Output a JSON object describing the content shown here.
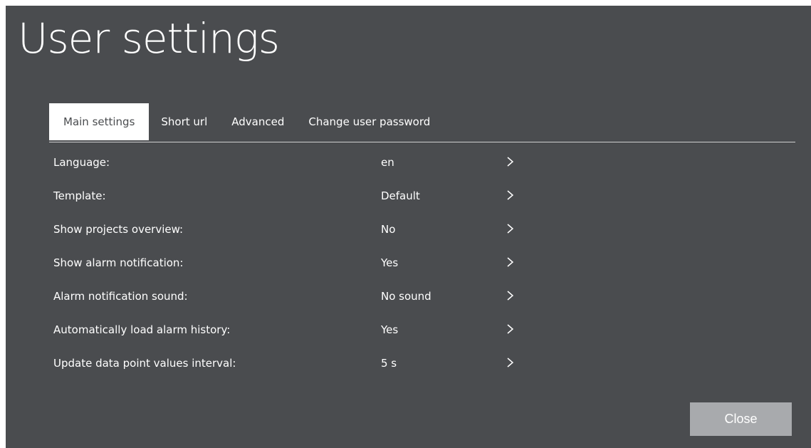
{
  "dialog": {
    "title": "User settings"
  },
  "tabs": [
    {
      "label": "Main settings",
      "active": true
    },
    {
      "label": "Short url",
      "active": false
    },
    {
      "label": "Advanced",
      "active": false
    },
    {
      "label": "Change user password",
      "active": false
    }
  ],
  "settings": [
    {
      "label": "Language:",
      "value": "en"
    },
    {
      "label": "Template:",
      "value": "Default"
    },
    {
      "label": "Show projects overview:",
      "value": "No"
    },
    {
      "label": "Show alarm notification:",
      "value": "Yes"
    },
    {
      "label": "Alarm notification sound:",
      "value": "No sound"
    },
    {
      "label": "Automatically load alarm history:",
      "value": "Yes"
    },
    {
      "label": "Update data point values interval:",
      "value": "5 s"
    }
  ],
  "footer": {
    "close_label": "Close"
  },
  "icons": {
    "row_action": "chevron-right-icon"
  },
  "colors": {
    "background": "#4a4c4f",
    "active_tab_bg": "#ffffff",
    "button_bg": "#a8aaad"
  }
}
